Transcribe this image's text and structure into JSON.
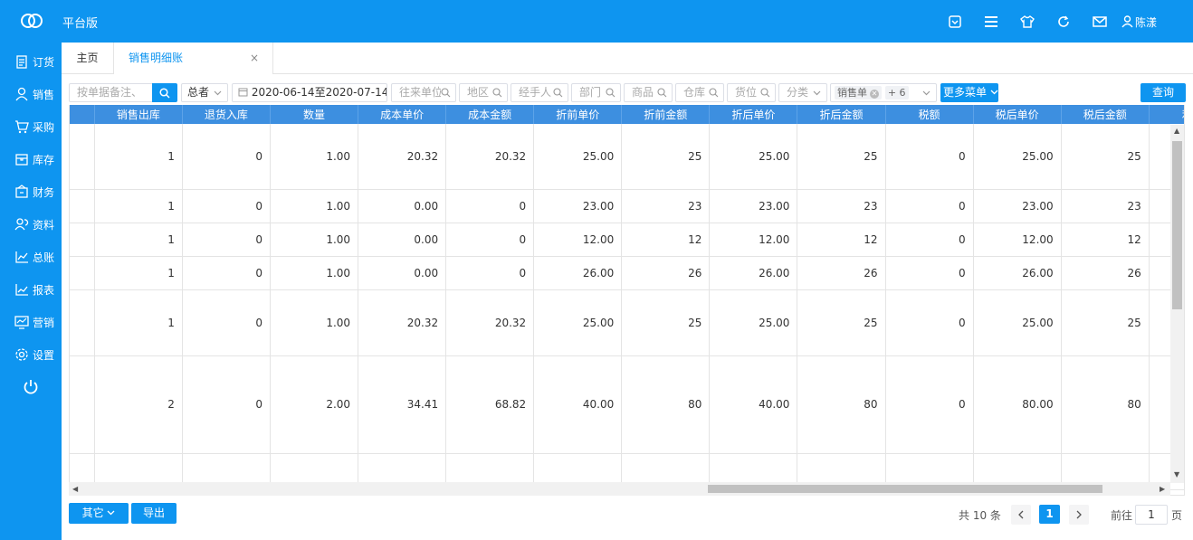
{
  "app": {
    "title": "平台版",
    "user": "陈漾"
  },
  "topbar_icons": [
    "check-square-icon",
    "menu-icon",
    "shirt-icon",
    "refresh-icon",
    "mail-icon",
    "user-icon"
  ],
  "sidebar": {
    "items": [
      {
        "label": "订货",
        "icon": "clipboard-icon"
      },
      {
        "label": "销售",
        "icon": "user-icon"
      },
      {
        "label": "采购",
        "icon": "cart-icon"
      },
      {
        "label": "库存",
        "icon": "box-icon"
      },
      {
        "label": "财务",
        "icon": "wallet-icon"
      },
      {
        "label": "资料",
        "icon": "users-icon"
      },
      {
        "label": "总账",
        "icon": "chart-icon"
      },
      {
        "label": "报表",
        "icon": "chart-icon"
      },
      {
        "label": "营销",
        "icon": "monitor-icon"
      },
      {
        "label": "设置",
        "icon": "gear-icon"
      }
    ]
  },
  "tabs": {
    "home": "主页",
    "active": "销售明细账",
    "close": "×"
  },
  "filters": {
    "search_placeholder": "按单据备注、",
    "summary_select": "总者",
    "date_from": "2020-06-14",
    "date_sep": "至",
    "date_to": "2020-07-14",
    "partner": "往来单位",
    "region": "地区",
    "handler": "经手人",
    "department": "部门",
    "product": "商品",
    "warehouse": "仓库",
    "location": "货位",
    "category": "分类",
    "bill_tag": "销售单",
    "bill_more": "+ 6",
    "more_menu": "更多菜单",
    "query": "查询"
  },
  "table": {
    "columns": [
      "",
      "销售出库",
      "退货入库",
      "数量",
      "成本单价",
      "成本金额",
      "折前单价",
      "折前金额",
      "折后单价",
      "折后金额",
      "税额",
      "税后单价",
      "税后金额",
      "利润"
    ],
    "rows": [
      [
        "",
        "1",
        "0",
        "1.00",
        "20.32",
        "20.32",
        "25.00",
        "25",
        "25.00",
        "25",
        "0",
        "25.00",
        "25",
        ""
      ],
      [
        "",
        "1",
        "0",
        "1.00",
        "0.00",
        "0",
        "23.00",
        "23",
        "23.00",
        "23",
        "0",
        "23.00",
        "23",
        ""
      ],
      [
        "",
        "1",
        "0",
        "1.00",
        "0.00",
        "0",
        "12.00",
        "12",
        "12.00",
        "12",
        "0",
        "12.00",
        "12",
        ""
      ],
      [
        "",
        "1",
        "0",
        "1.00",
        "0.00",
        "0",
        "26.00",
        "26",
        "26.00",
        "26",
        "0",
        "26.00",
        "26",
        ""
      ],
      [
        "",
        "1",
        "0",
        "1.00",
        "20.32",
        "20.32",
        "25.00",
        "25",
        "25.00",
        "25",
        "0",
        "25.00",
        "25",
        ""
      ],
      [
        "",
        "2",
        "0",
        "2.00",
        "34.41",
        "68.82",
        "40.00",
        "80",
        "40.00",
        "80",
        "0",
        "80.00",
        "80",
        ""
      ],
      [
        "",
        "",
        "",
        "",
        "",
        "",
        "",
        "",
        "",
        "",
        "",
        "",
        "",
        ""
      ]
    ]
  },
  "footer": {
    "other_btn": "其它",
    "export_btn": "导出",
    "total": "共 10 条",
    "current_page": "1",
    "goto_label": "前往",
    "goto_value": "1",
    "goto_suffix": "页"
  }
}
